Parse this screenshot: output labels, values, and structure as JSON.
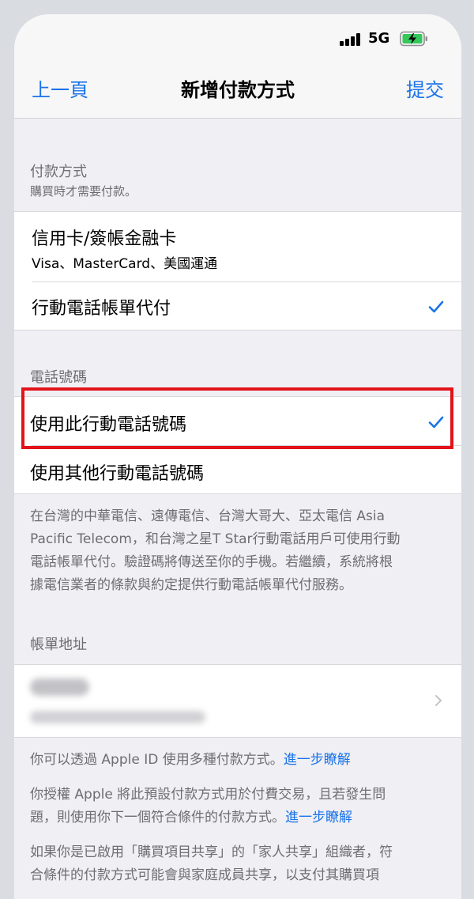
{
  "status_bar": {
    "network": "5G"
  },
  "nav": {
    "back_label": "上一頁",
    "title": "新增付款方式",
    "submit_label": "提交"
  },
  "payment_method": {
    "header": "付款方式",
    "subheader": "購買時才需要付款。",
    "options": [
      {
        "title": "信用卡/簽帳金融卡",
        "subtitle": "Visa、MasterCard、美國運通",
        "selected": false
      },
      {
        "title": "行動電話帳單代付",
        "selected": true
      }
    ]
  },
  "phone_number": {
    "header": "電話號碼",
    "options": [
      {
        "title": "使用此行動電話號碼",
        "selected": true
      },
      {
        "title": "使用其他行動電話號碼",
        "selected": false
      }
    ],
    "footnote_lines": [
      "在台灣的中華電信、遠傳電信、台灣大哥大、亞太電信 Asia",
      "Pacific Telecom，和台灣之星T Star行動電話用戶可使用行動",
      "電話帳單代付。驗證碼將傳送至你的手機。若繼續，系統將根",
      "據電信業者的條款與約定提供行動電話帳單代付服務。"
    ]
  },
  "billing_address": {
    "header": "帳單地址",
    "name": "HEllen",
    "address": "Chengkuo Taipei City TWN"
  },
  "notes": {
    "note1_text": "你可以透過 Apple ID 使用多種付款方式。",
    "note1_link": "進一步瞭解",
    "note2_line1": "你授權 Apple 將此預設付款方式用於付費交易，且若發生問",
    "note2_line2": "題，則使用你下一個符合條件的付款方式。",
    "note2_link": "進一步瞭解",
    "note3_line1": "如果你是已啟用「購買項目共享」的「家人共享」組織者，符",
    "note3_line2": "合條件的付款方式可能會與家庭成員共享，以支付其購買項"
  },
  "colors": {
    "accent": "#1a73e8",
    "highlight": "#e3131b",
    "background": "#efeff4"
  }
}
